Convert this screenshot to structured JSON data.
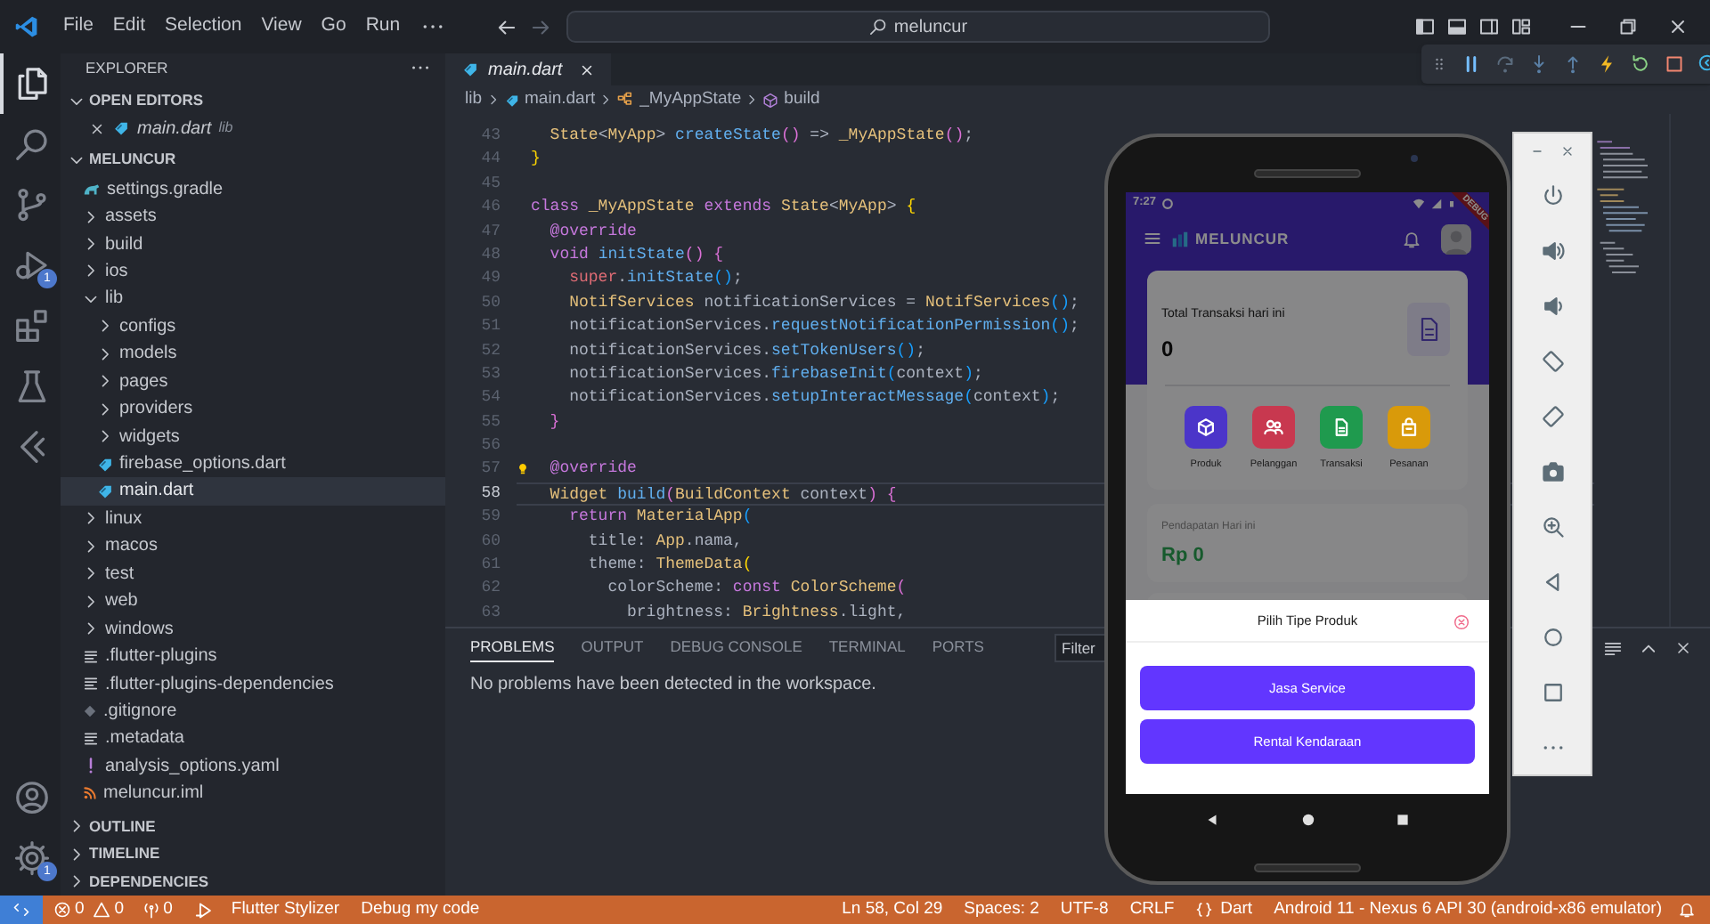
{
  "title_bar": {
    "menu": [
      "File",
      "Edit",
      "Selection",
      "View",
      "Go",
      "Run"
    ],
    "search": "meluncur"
  },
  "activity_bar": {
    "items": [
      {
        "selected": true
      },
      {
        "selected": false
      },
      {
        "selected": false
      },
      {
        "selected": false,
        "badge": "1"
      },
      {
        "selected": false
      },
      {
        "selected": false
      },
      {
        "selected": false
      }
    ],
    "bottom": [
      {
        "selected": false
      },
      {
        "selected": false,
        "badge": "1"
      }
    ]
  },
  "sidebar": {
    "title": "EXPLORER",
    "sections": [
      {
        "title": "OPEN EDITORS",
        "expanded": true,
        "kind": "open_editors",
        "items": [
          {
            "label": "main.dart",
            "hint": "lib",
            "kind": "dart",
            "selected": false
          }
        ]
      },
      {
        "title": "MELUNCUR",
        "expanded": true,
        "kind": "tree",
        "items": [
          {
            "label": "settings.gradle",
            "kind": "gradle",
            "selected": false
          },
          {
            "label": "assets",
            "kind": "folder",
            "expanded": false,
            "selected": false
          },
          {
            "label": "build",
            "kind": "folder",
            "expanded": false,
            "selected": false
          },
          {
            "label": "ios",
            "kind": "folder",
            "expanded": false,
            "selected": false
          },
          {
            "label": "lib",
            "kind": "folder",
            "expanded": true,
            "selected": false,
            "children": [
              {
                "label": "configs",
                "kind": "folder",
                "expanded": false,
                "selected": false
              },
              {
                "label": "models",
                "kind": "folder",
                "expanded": false,
                "selected": false
              },
              {
                "label": "pages",
                "kind": "folder",
                "expanded": false,
                "selected": false
              },
              {
                "label": "providers",
                "kind": "folder",
                "expanded": false,
                "selected": false
              },
              {
                "label": "widgets",
                "kind": "folder",
                "expanded": false,
                "selected": false
              },
              {
                "label": "firebase_options.dart",
                "kind": "dart",
                "selected": false
              },
              {
                "label": "main.dart",
                "kind": "dart",
                "selected": true
              }
            ]
          },
          {
            "label": "linux",
            "kind": "folder",
            "expanded": false,
            "selected": false
          },
          {
            "label": "macos",
            "kind": "folder",
            "expanded": false,
            "selected": false
          },
          {
            "label": "test",
            "kind": "folder",
            "expanded": false,
            "selected": false
          },
          {
            "label": "web",
            "kind": "folder",
            "expanded": false,
            "selected": false
          },
          {
            "label": "windows",
            "kind": "folder",
            "expanded": false,
            "selected": false
          },
          {
            "label": ".flutter-plugins",
            "kind": "text",
            "selected": false
          },
          {
            "label": ".flutter-plugins-dependencies",
            "kind": "text",
            "selected": false
          },
          {
            "label": ".gitignore",
            "kind": "git",
            "selected": false
          },
          {
            "label": ".metadata",
            "kind": "text",
            "selected": false
          },
          {
            "label": "analysis_options.yaml",
            "kind": "yaml",
            "selected": false
          },
          {
            "label": "meluncur.iml",
            "kind": "feed",
            "selected": false
          }
        ]
      },
      {
        "title": "OUTLINE",
        "expanded": false
      },
      {
        "title": "TIMELINE",
        "expanded": false
      },
      {
        "title": "DEPENDENCIES",
        "expanded": false
      }
    ]
  },
  "editor": {
    "tabs": [
      {
        "label": "main.dart",
        "selected": true
      }
    ],
    "breadcrumbs": [
      {
        "label": "lib",
        "kind": "folder"
      },
      {
        "label": "main.dart",
        "kind": "dart"
      },
      {
        "label": "_MyAppState",
        "kind": "class"
      },
      {
        "label": "build",
        "kind": "method"
      }
    ],
    "lines": [
      {
        "number": "43",
        "active": false,
        "lightbulb": false,
        "tokens": [
          {
            "text": "  State",
            "kind": "type"
          },
          {
            "text": "<",
            "kind": "plain"
          },
          {
            "text": "MyApp",
            "kind": "type"
          },
          {
            "text": "> ",
            "kind": "plain"
          },
          {
            "text": "createState",
            "kind": "function"
          },
          {
            "text": "()",
            "kind": "bracket2"
          },
          {
            "text": " => ",
            "kind": "plain"
          },
          {
            "text": "_MyAppState",
            "kind": "type"
          },
          {
            "text": "()",
            "kind": "bracket2"
          },
          {
            "text": ";",
            "kind": "plain"
          }
        ]
      },
      {
        "number": "44",
        "active": false,
        "lightbulb": false,
        "tokens": [
          {
            "text": "}",
            "kind": "bracket1"
          }
        ]
      },
      {
        "number": "45",
        "active": false,
        "lightbulb": false
      },
      {
        "number": "46",
        "active": false,
        "lightbulb": false,
        "tokens": [
          {
            "text": "class ",
            "kind": "keyword"
          },
          {
            "text": "_MyAppState ",
            "kind": "type"
          },
          {
            "text": "extends ",
            "kind": "keyword"
          },
          {
            "text": "State",
            "kind": "type"
          },
          {
            "text": "<",
            "kind": "plain"
          },
          {
            "text": "MyApp",
            "kind": "type"
          },
          {
            "text": "> ",
            "kind": "plain"
          },
          {
            "text": "{",
            "kind": "bracket1"
          }
        ]
      },
      {
        "number": "47",
        "active": false,
        "lightbulb": false,
        "tokens": [
          {
            "text": "  @override",
            "kind": "keyword"
          }
        ]
      },
      {
        "number": "48",
        "active": false,
        "lightbulb": false,
        "tokens": [
          {
            "text": "  void ",
            "kind": "keyword"
          },
          {
            "text": "initState",
            "kind": "function"
          },
          {
            "text": "() {",
            "kind": "bracket2"
          }
        ]
      },
      {
        "number": "49",
        "active": false,
        "lightbulb": false,
        "tokens": [
          {
            "text": "    super",
            "kind": "self"
          },
          {
            "text": ".",
            "kind": "plain"
          },
          {
            "text": "initState",
            "kind": "function"
          },
          {
            "text": "()",
            "kind": "bracket3"
          },
          {
            "text": ";",
            "kind": "plain"
          }
        ]
      },
      {
        "number": "50",
        "active": false,
        "lightbulb": false,
        "tokens": [
          {
            "text": "    NotifServices ",
            "kind": "type"
          },
          {
            "text": "notificationServices = ",
            "kind": "plain"
          },
          {
            "text": "NotifServices",
            "kind": "type"
          },
          {
            "text": "()",
            "kind": "bracket3"
          },
          {
            "text": ";",
            "kind": "plain"
          }
        ]
      },
      {
        "number": "51",
        "active": false,
        "lightbulb": false,
        "tokens": [
          {
            "text": "    notificationServices.",
            "kind": "plain"
          },
          {
            "text": "requestNotificationPermission",
            "kind": "function"
          },
          {
            "text": "()",
            "kind": "bracket3"
          },
          {
            "text": ";",
            "kind": "plain"
          }
        ]
      },
      {
        "number": "52",
        "active": false,
        "lightbulb": false,
        "tokens": [
          {
            "text": "    notificationServices.",
            "kind": "plain"
          },
          {
            "text": "setTokenUsers",
            "kind": "function"
          },
          {
            "text": "()",
            "kind": "bracket3"
          },
          {
            "text": ";",
            "kind": "plain"
          }
        ]
      },
      {
        "number": "53",
        "active": false,
        "lightbulb": false,
        "tokens": [
          {
            "text": "    notificationServices.",
            "kind": "plain"
          },
          {
            "text": "firebaseInit",
            "kind": "function"
          },
          {
            "text": "(",
            "kind": "bracket3"
          },
          {
            "text": "context",
            "kind": "plain"
          },
          {
            "text": ")",
            "kind": "bracket3"
          },
          {
            "text": ";",
            "kind": "plain"
          }
        ]
      },
      {
        "number": "54",
        "active": false,
        "lightbulb": false,
        "tokens": [
          {
            "text": "    notificationServices.",
            "kind": "plain"
          },
          {
            "text": "setupInteractMessage",
            "kind": "function"
          },
          {
            "text": "(",
            "kind": "bracket3"
          },
          {
            "text": "context",
            "kind": "plain"
          },
          {
            "text": ")",
            "kind": "bracket3"
          },
          {
            "text": ";",
            "kind": "plain"
          }
        ]
      },
      {
        "number": "55",
        "active": false,
        "lightbulb": false,
        "tokens": [
          {
            "text": "  }",
            "kind": "bracket2"
          }
        ]
      },
      {
        "number": "56",
        "active": false,
        "lightbulb": false
      },
      {
        "number": "57",
        "active": false,
        "lightbulb": true,
        "tokens": [
          {
            "text": "  @override",
            "kind": "keyword"
          }
        ]
      },
      {
        "number": "58",
        "active": true,
        "lightbulb": false,
        "tokens": [
          {
            "text": "  Widget ",
            "kind": "type"
          },
          {
            "text": "build",
            "kind": "function"
          },
          {
            "text": "(",
            "kind": "bracket2"
          },
          {
            "text": "BuildContext ",
            "kind": "type"
          },
          {
            "text": "context",
            "kind": "plain"
          },
          {
            "text": ")",
            "kind": "bracket2"
          },
          {
            "text": " {",
            "kind": "bracket2"
          }
        ]
      },
      {
        "number": "59",
        "active": false,
        "lightbulb": false,
        "tokens": [
          {
            "text": "    return ",
            "kind": "keyword"
          },
          {
            "text": "MaterialApp",
            "kind": "type"
          },
          {
            "text": "(",
            "kind": "bracket3"
          }
        ]
      },
      {
        "number": "60",
        "active": false,
        "lightbulb": false,
        "tokens": [
          {
            "text": "      title: ",
            "kind": "plain"
          },
          {
            "text": "App",
            "kind": "type"
          },
          {
            "text": ".nama,",
            "kind": "plain"
          }
        ]
      },
      {
        "number": "61",
        "active": false,
        "lightbulb": false,
        "tokens": [
          {
            "text": "      theme: ",
            "kind": "plain"
          },
          {
            "text": "ThemeData",
            "kind": "type"
          },
          {
            "text": "(",
            "kind": "bracket1"
          }
        ]
      },
      {
        "number": "62",
        "active": false,
        "lightbulb": false,
        "tokens": [
          {
            "text": "        colorScheme: ",
            "kind": "plain"
          },
          {
            "text": "const ",
            "kind": "keyword"
          },
          {
            "text": "ColorScheme",
            "kind": "type"
          },
          {
            "text": "(",
            "kind": "bracket2"
          }
        ]
      },
      {
        "number": "63",
        "active": false,
        "lightbulb": false,
        "tokens": [
          {
            "text": "          brightness: ",
            "kind": "plain"
          },
          {
            "text": "Brightness",
            "kind": "type"
          },
          {
            "text": ".light,",
            "kind": "plain"
          }
        ]
      }
    ]
  },
  "panel": {
    "tabs": [
      {
        "label": "PROBLEMS",
        "selected": true
      },
      {
        "label": "OUTPUT",
        "selected": false
      },
      {
        "label": "DEBUG CONSOLE",
        "selected": false
      },
      {
        "label": "TERMINAL",
        "selected": false
      },
      {
        "label": "PORTS",
        "selected": false
      }
    ],
    "filter_placeholder": "Filter",
    "message": "No problems have been detected in the workspace."
  },
  "status_bar": {
    "errors": "0",
    "warnings": "0",
    "ports": "0",
    "left_items": [
      "Flutter Stylizer",
      "Debug my code"
    ],
    "right_items": [
      "Ln 58, Col 29",
      "Spaces: 2",
      "UTF-8",
      "CRLF"
    ],
    "language": "Dart",
    "device": "Android 11 - Nexus 6 API 30 (android-x86 emulator)"
  },
  "emulator": {
    "time": "7:27",
    "debug_banner": "DEBUG",
    "app_name": "MELUNCUR",
    "summary": {
      "title": "Total Transaksi hari ini",
      "value": "0"
    },
    "actions": [
      {
        "label": "Produk",
        "color": "#4b35c9"
      },
      {
        "label": "Pelanggan",
        "color": "#c8384f"
      },
      {
        "label": "Transaksi",
        "color": "#1f9a4e"
      },
      {
        "label": "Pesanan",
        "color": "#d99a0a"
      }
    ],
    "income": {
      "title": "Pendapatan Hari ini",
      "value": "Rp 0"
    },
    "sheet": {
      "title": "Pilih Tipe Produk",
      "options": [
        "Jasa Service",
        "Rental Kendaraan"
      ]
    }
  }
}
